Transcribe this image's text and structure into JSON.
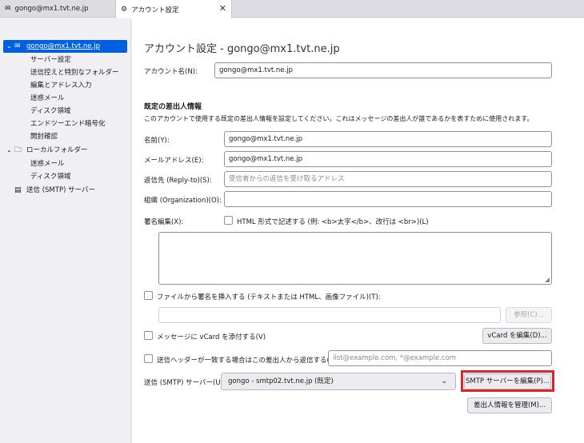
{
  "tabs": [
    {
      "label": "gongo@mx1.tvt.ne.jp",
      "icon": "mail-icon"
    },
    {
      "label": "アカウント設定",
      "icon": "gear-icon",
      "close": "✕"
    }
  ],
  "sidebar": {
    "account": "gongo@mx1.tvt.ne.jp",
    "account_children": [
      "サーバー設定",
      "送信控えと特別なフォルダー",
      "編集とアドレス入力",
      "迷惑メール",
      "ディスク領域",
      "エンドツーエンド暗号化",
      "開封確認"
    ],
    "local_folders": "ローカルフォルダー",
    "local_children": [
      "迷惑メール",
      "ディスク領域"
    ],
    "smtp": "送信 (SMTP) サーバー"
  },
  "main": {
    "title": "アカウント設定 - gongo@mx1.tvt.ne.jp",
    "account_name_label": "アカウント名(N):",
    "account_name_value": "gongo@mx1.tvt.ne.jp",
    "identity_heading": "既定の差出人情報",
    "identity_desc": "このアカウントで使用する既定の差出人情報を設定してください。これはメッセージの差出人が誰であるかを表すために使用されます。",
    "name_label": "名前(Y):",
    "name_value": "gongo@mx1.tvt.ne.jp",
    "email_label": "メールアドレス(E):",
    "email_value": "gongo@mx1.tvt.ne.jp",
    "replyto_label": "返信先 (Reply-to)(S):",
    "replyto_placeholder": "受信者からの返信を受け取るアドレス",
    "org_label": "組織 (Organization)(O):",
    "org_value": "",
    "sig_label": "署名編集(X):",
    "html_sig_label": "HTML 形式で記述する (例: <b>太字</b>、改行は <br>)(L)",
    "sig_file_label": "ファイルから署名を挿入する (テキストまたは HTML、画像ファイル)(T):",
    "browse_button": "参照(C)...",
    "vcard_label": "メッセージに vCard を添付する(V)",
    "vcard_button": "vCard を編集(D)...",
    "reply_from_label": "送信ヘッダーが一致する場合はこの差出人から返信する(R):",
    "reply_from_placeholder": "list@example.com, *@example.com",
    "smtp_label": "送信 (SMTP) サーバー(U):",
    "smtp_value": "gongo - smtp02.tvt.ne.jp (既定)",
    "smtp_edit_button": "SMTP サーバーを編集(P)...",
    "manage_identities_button": "差出人情報を管理(M)..."
  }
}
